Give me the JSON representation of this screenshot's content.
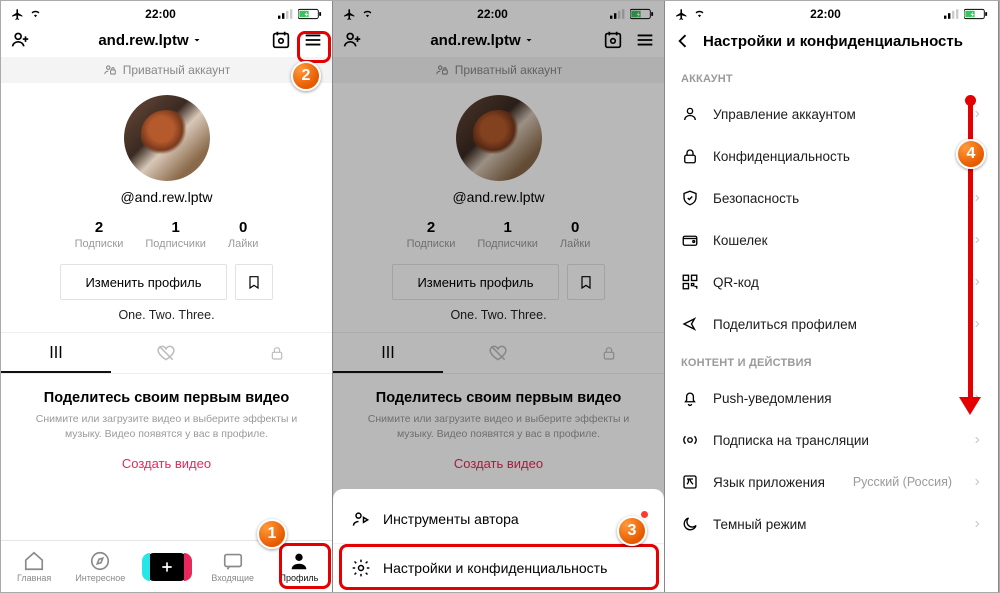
{
  "status": {
    "time": "22:00"
  },
  "profile": {
    "username": "and.rew.lptw",
    "private_label": "Приватный аккаунт",
    "handle": "@and.rew.lptw",
    "stats": {
      "following_n": "2",
      "following_l": "Подписки",
      "followers_n": "1",
      "followers_l": "Подписчики",
      "likes_n": "0",
      "likes_l": "Лайки"
    },
    "edit_btn": "Изменить профиль",
    "bio": "One. Two. Three.",
    "empty_title": "Поделитесь своим первым видео",
    "empty_sub": "Снимите или загрузите видео и выберите эффекты и музыку. Видео появятся у вас в профиле.",
    "create_link": "Создать видео"
  },
  "nav": {
    "home": "Главная",
    "discover": "Интересное",
    "inbox": "Входящие",
    "profile": "Профиль"
  },
  "sheet": {
    "creator_tools": "Инструменты автора",
    "settings": "Настройки и конфиденциальность"
  },
  "settings": {
    "title": "Настройки и конфиденциальность",
    "section_account": "АККАУНТ",
    "manage_account": "Управление аккаунтом",
    "privacy": "Конфиденциальность",
    "security": "Безопасность",
    "wallet": "Кошелек",
    "qr": "QR-код",
    "share_profile": "Поделиться профилем",
    "section_content": "КОНТЕНТ И ДЕЙСТВИЯ",
    "push": "Push-уведомления",
    "live_sub": "Подписка на трансляции",
    "app_lang": "Язык приложения",
    "app_lang_val": "Русский (Россия)",
    "dark_mode": "Темный режим"
  },
  "callouts": {
    "c1": "1",
    "c2": "2",
    "c3": "3",
    "c4": "4"
  }
}
